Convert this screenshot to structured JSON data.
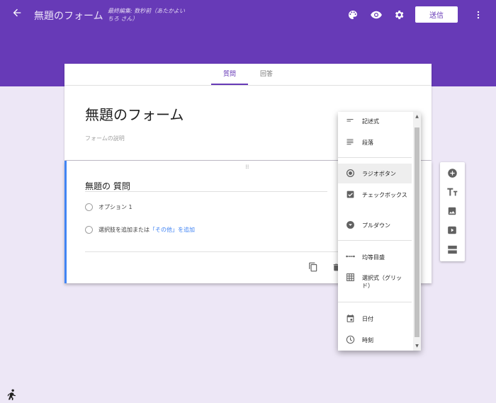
{
  "header": {
    "form_title": "無題のフォーム",
    "last_edit": "最終編集: 数秒前（あたかよいちろ さん）",
    "send_label": "送信",
    "icons": [
      "back-arrow-icon",
      "palette-icon",
      "eye-icon",
      "gear-icon",
      "more-vert-icon"
    ],
    "theme_color": "#673ab7"
  },
  "tabs": [
    {
      "label": "質問",
      "active": true
    },
    {
      "label": "回答",
      "active": false
    }
  ],
  "form": {
    "title": "無題のフォーム",
    "description_placeholder": "フォームの説明"
  },
  "question": {
    "title": "無題の 質問",
    "option1": "オプション 1",
    "add_option": "選択肢を追加",
    "or_text": " または ",
    "add_other": "「その他」を追加",
    "accent": "#4285f4"
  },
  "type_menu": {
    "items": [
      {
        "label": "記述式",
        "icon": "short-text-icon"
      },
      {
        "label": "段落",
        "icon": "paragraph-icon"
      },
      {
        "label": "ラジオボタン",
        "icon": "radio-button-icon",
        "selected": true
      },
      {
        "label": "チェックボックス",
        "icon": "checkbox-icon"
      },
      {
        "label": "プルダウン",
        "icon": "dropdown-icon"
      },
      {
        "label": "均等目盛",
        "icon": "linear-scale-icon"
      },
      {
        "label": "選択式（グリッド）",
        "icon": "grid-icon"
      },
      {
        "label": "日付",
        "icon": "calendar-icon"
      },
      {
        "label": "時刻",
        "icon": "clock-icon"
      }
    ]
  },
  "side_toolbar": [
    "add-question-icon",
    "add-title-icon",
    "add-image-icon",
    "add-video-icon",
    "add-section-icon"
  ]
}
